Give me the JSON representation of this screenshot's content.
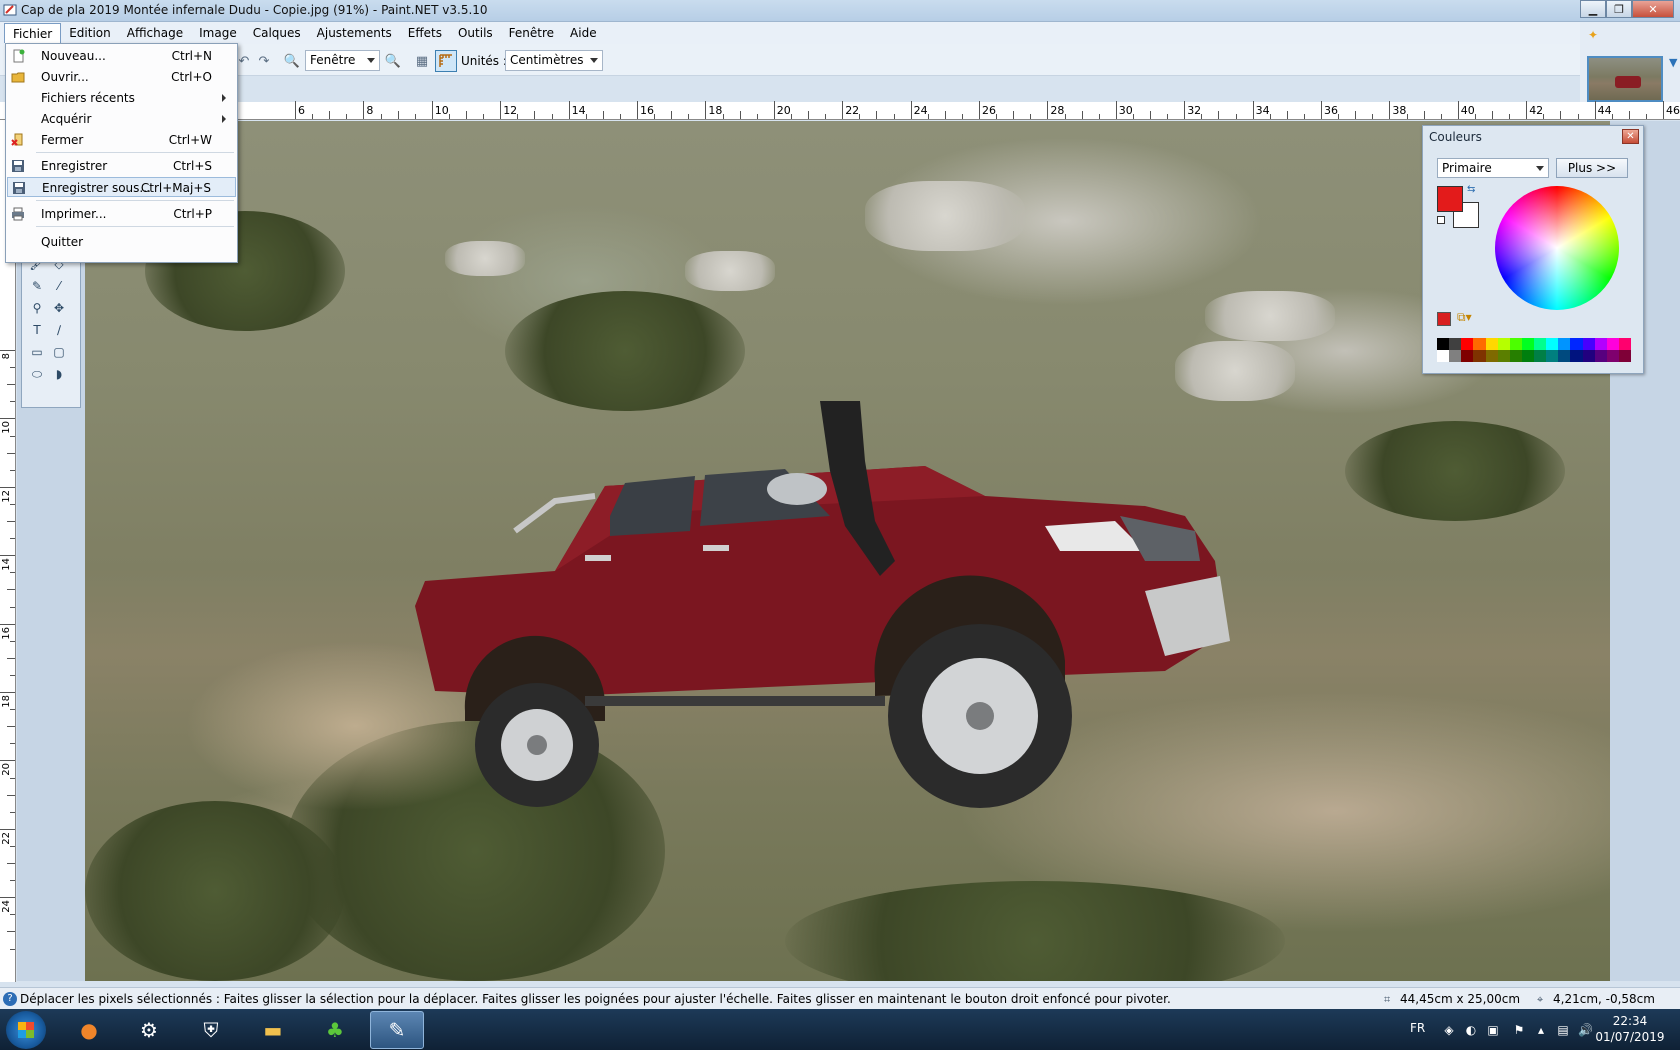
{
  "window": {
    "title": "Cap de pla 2019 Montée infernale Dudu - Copie.jpg (91%) - Paint.NET v3.5.10"
  },
  "menubar": {
    "items": [
      "Fichier",
      "Edition",
      "Affichage",
      "Image",
      "Calques",
      "Ajustements",
      "Effets",
      "Outils",
      "Fenêtre",
      "Aide"
    ]
  },
  "toolbar": {
    "zoom_select": "Fenêtre",
    "units_label": "Unités :",
    "units_select": "Centimètres"
  },
  "file_menu": {
    "items": [
      {
        "label": "Nouveau...",
        "shortcut": "Ctrl+N",
        "icon": "new-file-icon"
      },
      {
        "label": "Ouvrir...",
        "shortcut": "Ctrl+O",
        "icon": "open-folder-icon"
      },
      {
        "label": "Fichiers récents",
        "shortcut": "",
        "submenu": true
      },
      {
        "label": "Acquérir",
        "shortcut": "",
        "submenu": true
      },
      {
        "label": "Fermer",
        "shortcut": "Ctrl+W",
        "icon": "close-file-icon"
      },
      {
        "label": "Enregistrer",
        "shortcut": "Ctrl+S",
        "icon": "save-icon"
      },
      {
        "label": "Enregistrer sous...",
        "shortcut": "Ctrl+Maj+S",
        "icon": "save-as-icon",
        "highlighted": true
      },
      {
        "label": "Imprimer...",
        "shortcut": "Ctrl+P",
        "icon": "print-icon"
      },
      {
        "label": "Quitter",
        "shortcut": ""
      }
    ]
  },
  "ruler": {
    "top_labels": [
      "6",
      "8",
      "10",
      "12",
      "14",
      "16",
      "18",
      "20",
      "22",
      "24",
      "26",
      "28",
      "30",
      "32",
      "34",
      "36",
      "38",
      "40",
      "42",
      "44",
      "46"
    ],
    "left_labels": [
      "8",
      "10",
      "12",
      "14",
      "16",
      "18",
      "20",
      "22",
      "24"
    ]
  },
  "colors_window": {
    "title": "Couleurs",
    "mode_select": "Primaire",
    "more_button": "Plus >>",
    "primary_color": "#e31b1b",
    "secondary_color": "#ffffff",
    "palette": [
      "#000000",
      "#404040",
      "#ff0000",
      "#ff6a00",
      "#ffd800",
      "#b6ff00",
      "#4cff00",
      "#00ff21",
      "#00ff90",
      "#00ffff",
      "#0094ff",
      "#0026ff",
      "#4800ff",
      "#b200ff",
      "#ff00dc",
      "#ff006e",
      "#ffffff",
      "#808080",
      "#7f0000",
      "#7f3300",
      "#7f6a00",
      "#5b7f00",
      "#267f00",
      "#007f0e",
      "#007f46",
      "#007f7f",
      "#004a7f",
      "#00137f",
      "#21007f",
      "#57007f",
      "#7f006e",
      "#7f0037"
    ]
  },
  "statusbar": {
    "help_text": "Déplacer les pixels sélectionnés : Faites glisser la sélection pour la déplacer. Faites glisser les poignées pour ajuster l'échelle. Faites glisser en maintenant le bouton droit enfoncé pour pivoter.",
    "image_size": "44,45cm x 25,00cm",
    "cursor_position": "4,21cm, -0,58cm"
  },
  "taskbar": {
    "language": "FR",
    "time": "22:34",
    "date": "01/07/2019"
  }
}
